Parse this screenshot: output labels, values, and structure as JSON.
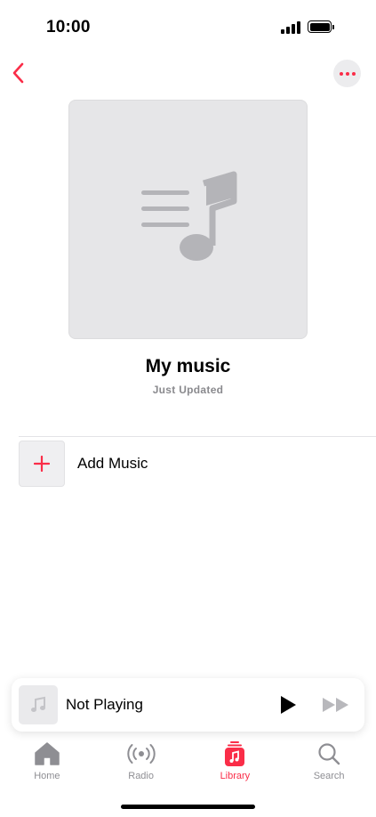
{
  "status_bar": {
    "time": "10:00"
  },
  "navigation": {
    "back_icon": "chevron-left-icon",
    "more_icon": "ellipsis-icon"
  },
  "playlist": {
    "title": "My music",
    "subtitle": "Just Updated",
    "artwork_icon": "music-note-list-icon"
  },
  "add_music": {
    "label": "Add Music",
    "icon": "plus-icon"
  },
  "mini_player": {
    "title": "Not Playing",
    "artwork_icon": "music-note-icon",
    "play_icon": "play-icon",
    "forward_icon": "forward-icon"
  },
  "tabs": [
    {
      "label": "Home",
      "icon": "home-icon",
      "active": false
    },
    {
      "label": "Radio",
      "icon": "radio-icon",
      "active": false
    },
    {
      "label": "Library",
      "icon": "library-icon",
      "active": true
    },
    {
      "label": "Search",
      "icon": "search-icon",
      "active": false
    }
  ],
  "colors": {
    "accent": "#fa2d48",
    "inactive": "#8e8e93",
    "artwork_bg": "#e6e6e8"
  }
}
